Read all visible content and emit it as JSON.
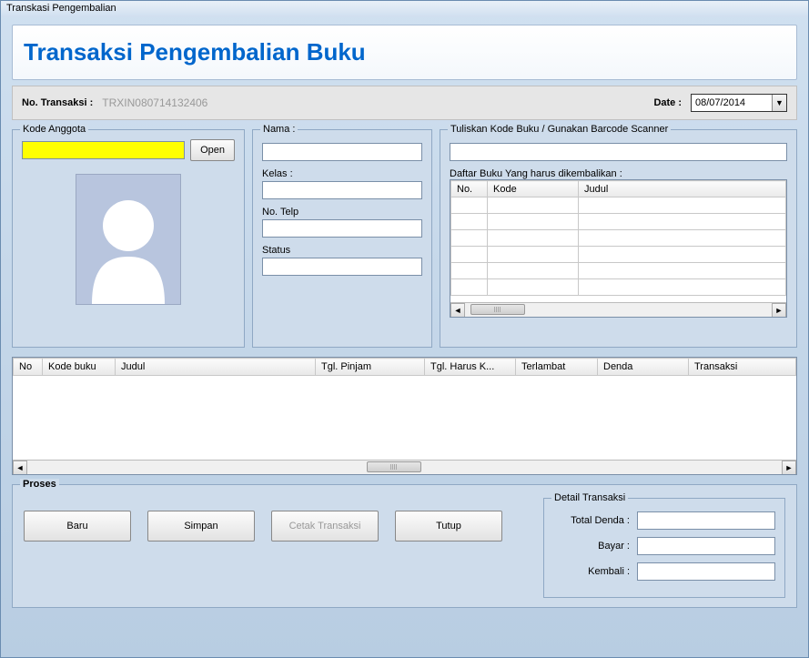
{
  "window_title": "Transkasi Pengembalian",
  "header_title": "Transaksi Pengembalian Buku",
  "trx": {
    "label": "No. Transaksi :",
    "value": "TRXIN080714132406",
    "date_label": "Date :",
    "date_value": "08/07/2014"
  },
  "member": {
    "legend": "Kode Anggota",
    "code_value": "",
    "open_btn": "Open"
  },
  "info": {
    "nama_label": "Nama :",
    "nama_value": "",
    "kelas_label": "Kelas :",
    "kelas_value": "",
    "telp_label": "No. Telp",
    "telp_value": "",
    "status_label": "Status",
    "status_value": ""
  },
  "scan": {
    "legend": "Tuliskan Kode Buku / Gunakan Barcode Scanner",
    "barcode_value": "",
    "list_label": "Daftar Buku Yang harus dikembalikan :",
    "cols": {
      "no": "No.",
      "kode": "Kode",
      "judul": "Judul"
    }
  },
  "main_cols": {
    "no": "No",
    "kode": "Kode buku",
    "judul": "Judul",
    "tgl_pinjam": "Tgl. Pinjam",
    "tgl_harus": "Tgl. Harus K...",
    "terlambat": "Terlambat",
    "denda": "Denda",
    "transaksi": "Transaksi"
  },
  "proses": {
    "legend": "Proses",
    "baru": "Baru",
    "simpan": "Simpan",
    "cetak": "Cetak Transaksi",
    "tutup": "Tutup"
  },
  "detail": {
    "legend": "Detail Transaksi",
    "total_label": "Total Denda :",
    "total_value": "",
    "bayar_label": "Bayar :",
    "bayar_value": "",
    "kembali_label": "Kembali :",
    "kembali_value": ""
  }
}
